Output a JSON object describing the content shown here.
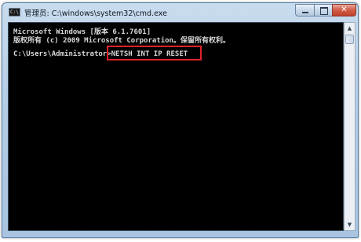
{
  "window": {
    "title": "管理员: C:\\windows\\system32\\cmd.exe",
    "title_icon_text": "C:\\"
  },
  "controls": {
    "minimize": "minimize-icon",
    "maximize": "maximize-icon",
    "close_glyph": "✕"
  },
  "console": {
    "lines": [
      "Microsoft Windows [版本 6.1.7601]",
      "版权所有 (c) 2009 Microsoft Corporation。保留所有权利。",
      "",
      "C:\\Users\\Administrator>NETSH INT IP RESET"
    ],
    "highlight_color": "#e0202a",
    "text_color": "#d9d9d9",
    "background_color": "#000000"
  },
  "scrollbar": {
    "up_arrow": "▲",
    "down_arrow": "▼"
  }
}
